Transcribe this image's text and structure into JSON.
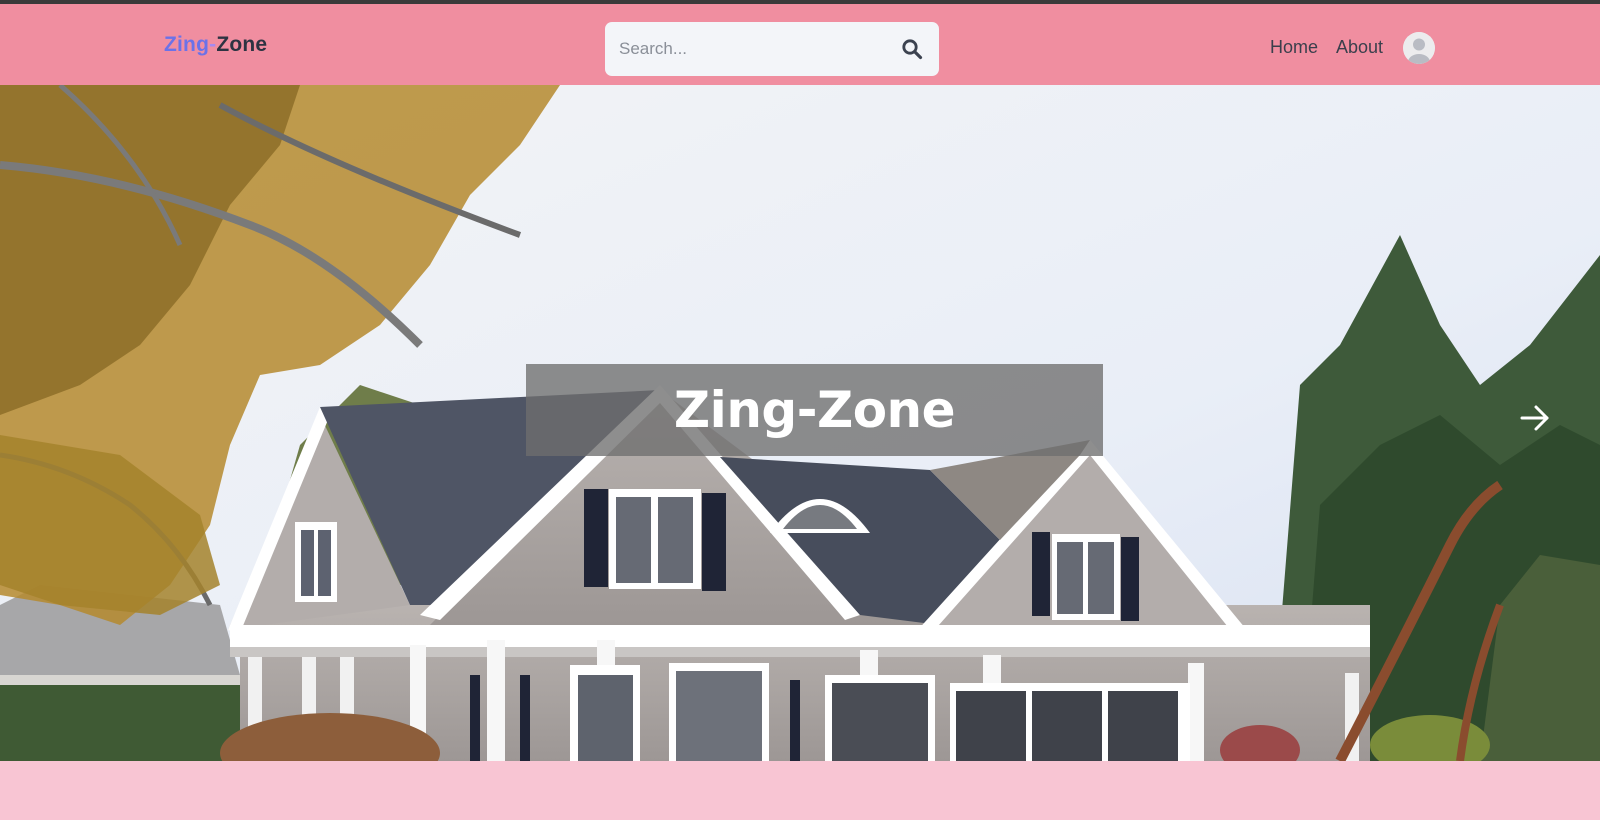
{
  "navbar": {
    "brand": {
      "part1": "Zing",
      "dash": "-",
      "part2": "Zone"
    },
    "search": {
      "placeholder": "Search...",
      "value": "",
      "icon": "search-icon"
    },
    "links": [
      {
        "label": "Home"
      },
      {
        "label": "About"
      }
    ],
    "avatar": {
      "icon": "user-avatar-icon"
    }
  },
  "hero": {
    "title": "Zing-Zone",
    "next_icon": "arrow-right-icon"
  },
  "colors": {
    "top_strip": "#3a3a3a",
    "navbar_bg": "#f08ea0",
    "page_bg": "#f8c5d3",
    "brand_zing": "#6b72e8",
    "brand_zone": "#2d3342",
    "title_overlay": "rgba(110,110,110,0.78)"
  }
}
